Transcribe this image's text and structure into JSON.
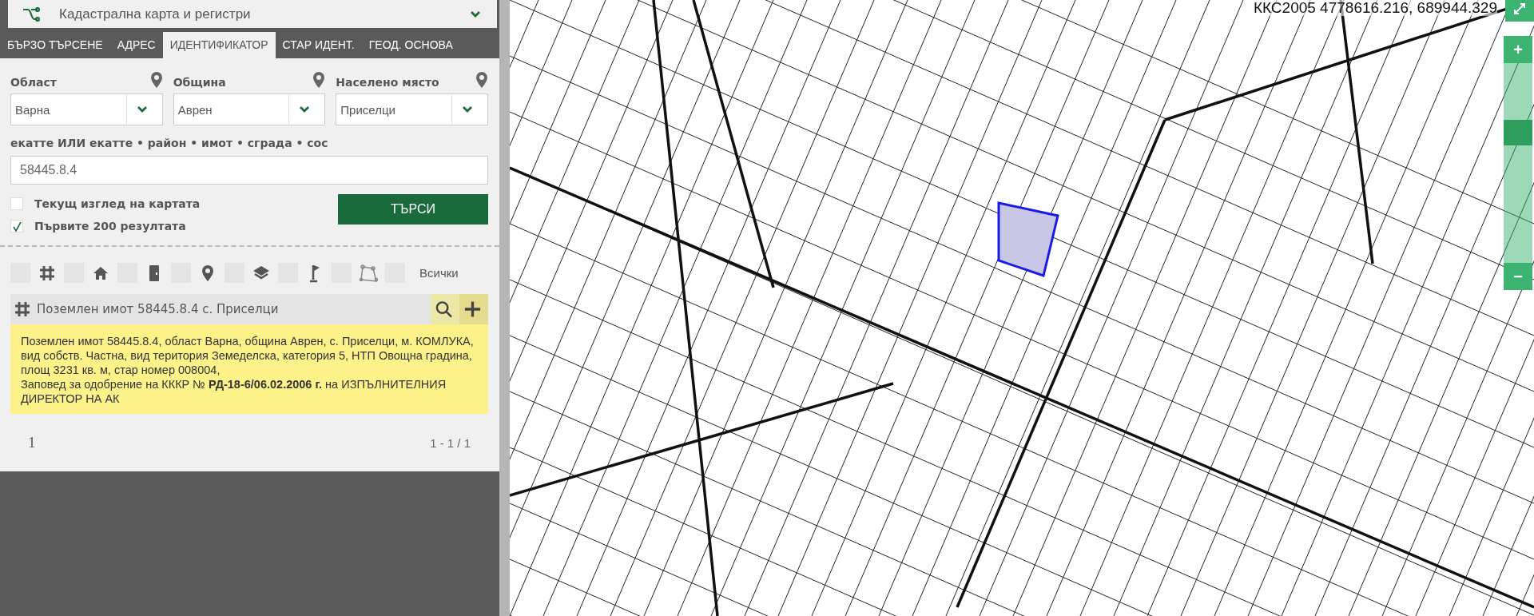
{
  "app_bar": {
    "title": "Кадастрална карта и регистри"
  },
  "tabs": [
    {
      "label": "БЪРЗО ТЪРСЕНЕ",
      "selected": false
    },
    {
      "label": "АДРЕС",
      "selected": false
    },
    {
      "label": "ИДЕНТИФИКАТОР",
      "selected": true
    },
    {
      "label": "СТАР ИДЕНТ.",
      "selected": false
    },
    {
      "label": "ГЕОД. ОСНОВА",
      "selected": false
    }
  ],
  "form": {
    "selects": [
      {
        "label": "Област",
        "value": "Варна"
      },
      {
        "label": "Община",
        "value": "Аврен"
      },
      {
        "label": "Населено място",
        "value": "Приселци"
      }
    ],
    "identifier": {
      "label": "екатте ИЛИ екатте • район • имот • сграда • сос",
      "value": "58445.8.4"
    },
    "checkboxes": [
      {
        "label": "Текущ изглед на картата",
        "checked": false
      },
      {
        "label": "Първите 200 резултата",
        "checked": true
      }
    ],
    "search_button": "ТЪРСИ"
  },
  "filters": [
    {
      "kind": "parcel",
      "checked": false
    },
    {
      "kind": "building",
      "checked": false
    },
    {
      "kind": "unit",
      "checked": false
    },
    {
      "kind": "point",
      "checked": false
    },
    {
      "kind": "layers",
      "checked": false
    },
    {
      "kind": "flag",
      "checked": false
    },
    {
      "kind": "polygon",
      "checked": false
    },
    {
      "kind": "all",
      "label": "Всички",
      "checked": false
    }
  ],
  "results": [
    {
      "title": "Поземлен имот 58445.8.4 с. Приселци",
      "description": "Поземлен имот 58445.8.4, област Варна, община Аврен, с. Приселци, м. КОМЛУКА, вид собств. Частна, вид територия Земеделска, категория 5, НТП Овощна градина, площ 3231 кв. м, стар номер 008004,\nЗаповед за одобрение на КККР № **РД-18-6/06.02.2006 г.** на ИЗПЪЛНИТЕЛНИЯ ДИРЕКТОР НА АК"
    }
  ],
  "pagination": {
    "page": "1",
    "range": "1 - 1 / 1"
  },
  "map": {
    "coordinates": "ККС2005 4778616.216, 689944.329",
    "zoom": {
      "in": "+",
      "out": "−",
      "level": 0.67
    }
  }
}
